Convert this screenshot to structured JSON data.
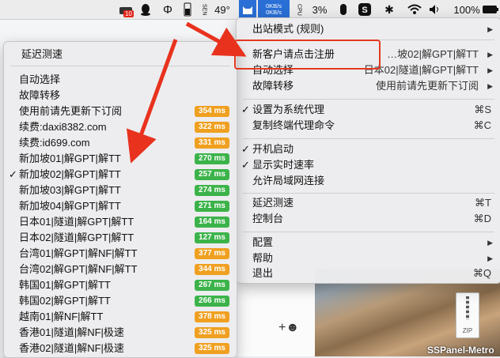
{
  "menubar": {
    "badge": "10",
    "cpu_label": "SEN",
    "temp": "49°",
    "speed_up": "0KB/s",
    "speed_down": "0KB/s",
    "cpu_percent": "3%",
    "battery_percent": "100%"
  },
  "main_menu": {
    "items": [
      {
        "label": "出站模式 (规则)",
        "right": "",
        "arrow": true
      },
      {
        "label": "新客户请点击注册",
        "right": "…坡02|解GPT|解TT",
        "arrow": true
      },
      {
        "label": "自动选择",
        "right": "日本02|隧道|解GPT|解TT",
        "arrow": true
      },
      {
        "label": "故障转移",
        "right": "使用前请先更新下订阅",
        "arrow": true
      },
      {
        "label": "设置为系统代理",
        "right": "⌘S",
        "checked": true
      },
      {
        "label": "复制终端代理命令",
        "right": "⌘C"
      },
      {
        "label": "开机启动",
        "right": "",
        "checked": true
      },
      {
        "label": "显示实时速率",
        "right": "",
        "checked": true
      },
      {
        "label": "允许局域网连接",
        "right": ""
      },
      {
        "label": "延迟测速",
        "right": "⌘T"
      },
      {
        "label": "控制台",
        "right": "⌘D"
      },
      {
        "label": "配置",
        "right": "",
        "arrow": true
      },
      {
        "label": "帮助",
        "right": "",
        "arrow": true
      },
      {
        "label": "退出",
        "right": "⌘Q"
      }
    ]
  },
  "sub_menu": {
    "header": "延迟测速",
    "items": [
      {
        "label": "自动选择",
        "ms": ""
      },
      {
        "label": "故障转移",
        "ms": ""
      },
      {
        "label": "使用前请先更新下订阅",
        "ms": "354 ms",
        "color": "#f0a020"
      },
      {
        "label": "续费:daxi8382.com",
        "ms": "322 ms",
        "color": "#f0a020"
      },
      {
        "label": "续费:id699.com",
        "ms": "331 ms",
        "color": "#f0a020"
      },
      {
        "label": "新加坡01|解GPT|解TT",
        "ms": "270 ms",
        "color": "#3cb34a"
      },
      {
        "label": "新加坡02|解GPT|解TT",
        "ms": "257 ms",
        "color": "#3cb34a",
        "checked": true
      },
      {
        "label": "新加坡03|解GPT|解TT",
        "ms": "274 ms",
        "color": "#3cb34a"
      },
      {
        "label": "新加坡04|解GPT|解TT",
        "ms": "271 ms",
        "color": "#3cb34a"
      },
      {
        "label": "日本01|隧道|解GPT|解TT",
        "ms": "164 ms",
        "color": "#3cb34a"
      },
      {
        "label": "日本02|隧道|解GPT|解TT",
        "ms": "127 ms",
        "color": "#3cb34a"
      },
      {
        "label": "台湾01|解GPT|解NF|解TT",
        "ms": "377 ms",
        "color": "#f0a020"
      },
      {
        "label": "台湾02|解GPT|解NF|解TT",
        "ms": "344 ms",
        "color": "#f0a020"
      },
      {
        "label": "韩国01|解GPT|解TT",
        "ms": "267 ms",
        "color": "#3cb34a"
      },
      {
        "label": "韩国02|解GPT|解TT",
        "ms": "266 ms",
        "color": "#3cb34a"
      },
      {
        "label": "越南01|解NF|解TT",
        "ms": "378 ms",
        "color": "#f0a020"
      },
      {
        "label": "香港01|隧道|解NF|极速",
        "ms": "325 ms",
        "color": "#f0a020"
      },
      {
        "label": "香港02|隧道|解NF|极速",
        "ms": "325 ms",
        "color": "#f0a020"
      }
    ]
  },
  "desktop": {
    "zip_label": "ZIP",
    "filename": "SSPanel-Metro"
  }
}
